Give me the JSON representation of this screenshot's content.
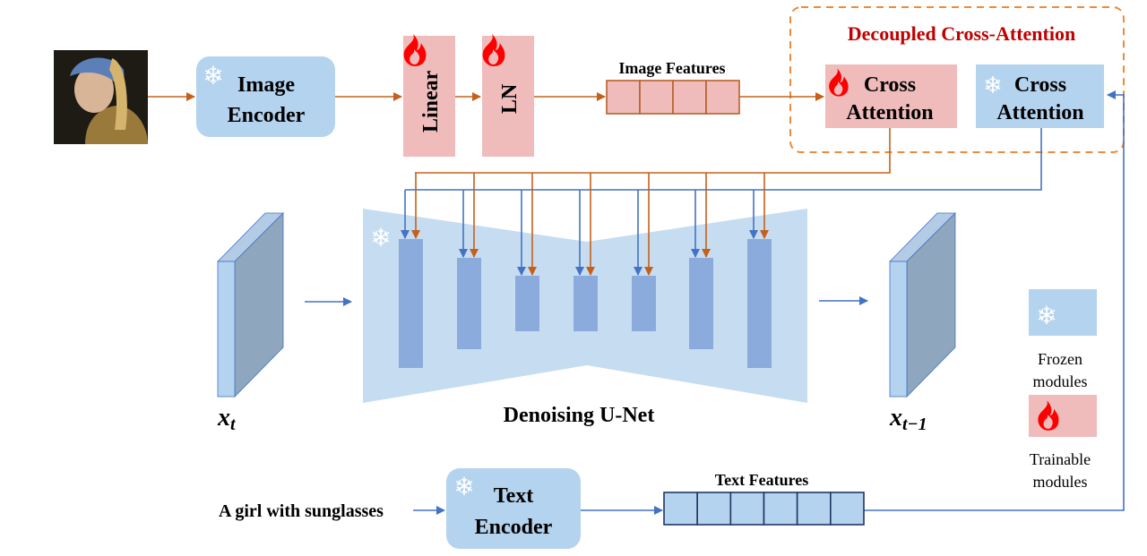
{
  "colors": {
    "frozen": "#b4d3ef",
    "trainable": "#efbcbb",
    "image_path": "#c5601a",
    "text_path": "#4472c4",
    "dashed_border": "#ee8a3c",
    "title": "#c00000",
    "unet": "#c6dcf1",
    "unet_block": "#8aabdc"
  },
  "icons": {
    "frozen": "snowflake-icon",
    "trainable": "flame-icon"
  },
  "image_encoder": {
    "line1": "Image",
    "line2": "Encoder"
  },
  "linear": {
    "label": "Linear"
  },
  "ln": {
    "label": "LN"
  },
  "image_features": {
    "label": "Image Features",
    "cells": 4
  },
  "decoupled": {
    "title": "Decoupled Cross-Attention"
  },
  "cross_attn_trainable": {
    "line1": "Cross",
    "line2": "Attention"
  },
  "cross_attn_frozen": {
    "line1": "Cross",
    "line2": "Attention"
  },
  "unet": {
    "label": "Denoising U-Net"
  },
  "latent_in": {
    "base": "x",
    "sub": "t"
  },
  "latent_out": {
    "base": "x",
    "sub": "t−1"
  },
  "legend": {
    "frozen": {
      "line1": "Frozen",
      "line2": "modules"
    },
    "trainable": {
      "line1": "Trainable",
      "line2": "modules"
    }
  },
  "prompt": {
    "text": "A girl with sunglasses"
  },
  "text_encoder": {
    "line1": "Text",
    "line2": "Encoder"
  },
  "text_features": {
    "label": "Text Features",
    "cells": 6
  }
}
